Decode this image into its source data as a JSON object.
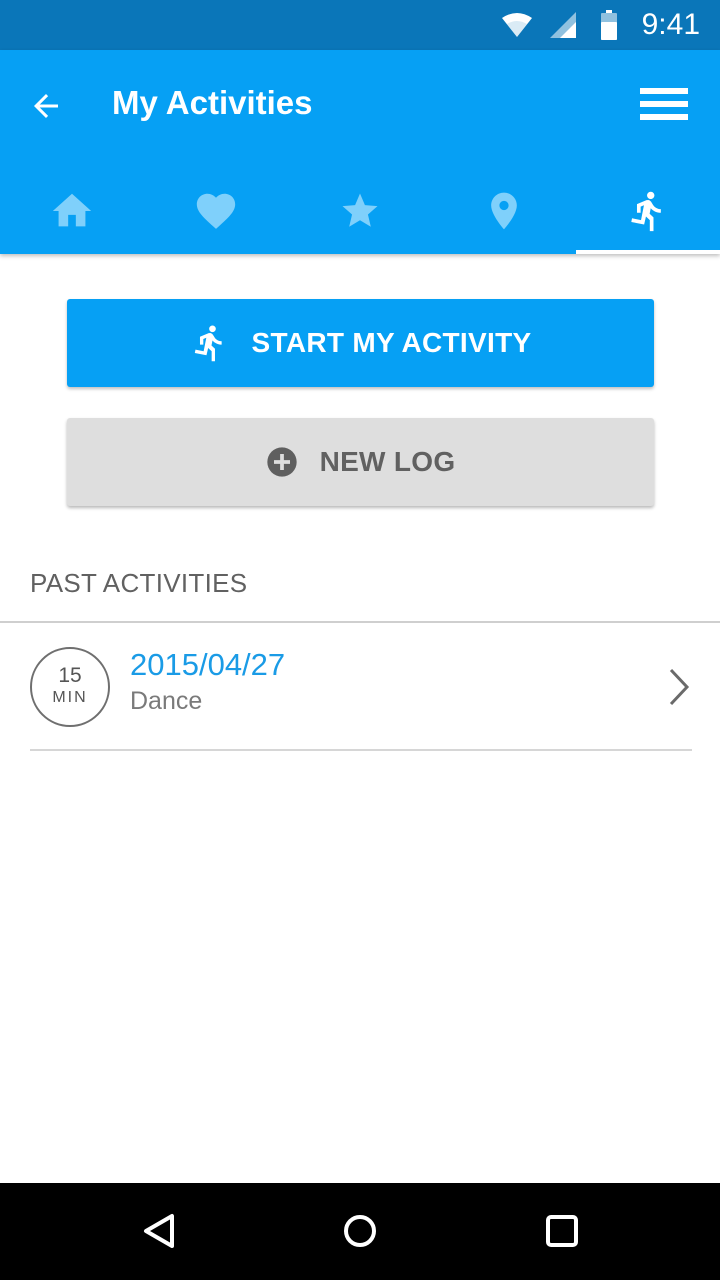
{
  "status_bar": {
    "time": "9:41",
    "icons": [
      "wifi-icon",
      "signal-icon",
      "battery-icon"
    ]
  },
  "app_bar": {
    "title": "My Activities",
    "back_icon": "arrow-left-icon",
    "menu_icon": "menu-icon",
    "tabs": [
      {
        "icon": "home-icon",
        "selected": false
      },
      {
        "icon": "heart-icon",
        "selected": false
      },
      {
        "icon": "star-icon",
        "selected": false
      },
      {
        "icon": "location-pin-icon",
        "selected": false
      },
      {
        "icon": "running-person-icon",
        "selected": true
      }
    ]
  },
  "actions": {
    "start_label": "START MY ACTIVITY",
    "start_icon": "running-person-icon",
    "new_log_label": "NEW LOG",
    "new_log_icon": "plus-circle-icon"
  },
  "past_activities": {
    "header": "PAST ACTIVITIES",
    "items": [
      {
        "duration": "15",
        "unit": "MIN",
        "date": "2015/04/27",
        "type": "Dance"
      }
    ]
  },
  "nav_bar": {
    "buttons": [
      "back-triangle-icon",
      "home-circle-icon",
      "recents-square-icon"
    ]
  },
  "colors": {
    "status_bar": "#0a76b9",
    "primary": "#06a0f4",
    "tab_icon_inactive": "#7fd0fb",
    "date_text": "#1a9be6",
    "secondary_button": "#dedede"
  }
}
